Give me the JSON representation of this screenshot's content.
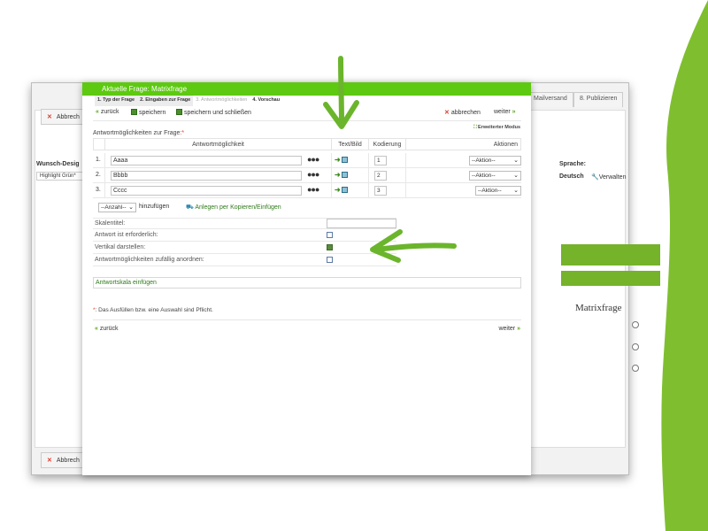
{
  "colors": {
    "accent_green": "#5dc910",
    "blob_green": "#7fbf2f",
    "link_green": "#5ba71c",
    "cancel_red": "#e03a2b"
  },
  "background": {
    "tabs": [
      "Mailversand",
      "8. Publizieren"
    ],
    "cancel_label": "Abbrech",
    "left_heading": "Wunsch-Desig",
    "left_value": "Highlight Grün*",
    "language_heading": "Sprache:",
    "language_value": "Deutsch",
    "manage_label": "Verwalten",
    "manage_icon": "wrench-icon",
    "preview_title": "Matrixfrage",
    "radio_count": 3
  },
  "modal": {
    "title": "Aktuelle Frage: Matrixfrage",
    "steps": [
      {
        "label": "1. Typ der Frage",
        "state": "done"
      },
      {
        "label": "2. Eingaben zur Frage",
        "state": "done"
      },
      {
        "label": "3. Antwortmöglichkeiten",
        "state": "inactive"
      },
      {
        "label": "4. Vorschau",
        "state": "current"
      }
    ],
    "toolbar": {
      "back": "zurück",
      "back_icon": "«",
      "save": "speichern",
      "save_close": "speichern und schließen",
      "cancel": "abbrechen",
      "cancel_icon": "✕",
      "next": "weiter",
      "next_icon": "»"
    },
    "answers_label": "Antwortmöglichkeiten zur Frage",
    "required_mark": ":*",
    "advanced_mode": "Erweiterter Modus",
    "table": {
      "headers": {
        "answer": "Antwortmöglichkeit",
        "textimage": "Text/Bild",
        "coding": "Kodierung",
        "actions": "Aktionen"
      },
      "rows": [
        {
          "num": "1.",
          "answer": "Aaaa",
          "code": "1",
          "action": "--Aktion--"
        },
        {
          "num": "2.",
          "answer": "Bbbb",
          "code": "2",
          "action": "--Aktion--"
        },
        {
          "num": "3.",
          "answer": "Cccc",
          "code": "3",
          "action": "--Aktion--"
        }
      ],
      "dots": "●●●"
    },
    "add": {
      "count_select": "--Anzahl--",
      "add_label": "hinzufügen",
      "copy_paste": "Anlegen per Kopieren/Einfügen"
    },
    "options": [
      {
        "label": "Skalentitel:",
        "control": "text"
      },
      {
        "label": "Antwort ist erforderlich:",
        "control": "checkbox",
        "checked": false
      },
      {
        "label": "Vertikal darstellen:",
        "control": "checkbox",
        "checked": true
      },
      {
        "label": "Antwortmöglichkeiten zufällig anordnen:",
        "control": "checkbox",
        "checked": false
      }
    ],
    "scale_insert": "Antwortskala einfügen",
    "footnote_mark": "*",
    "footnote": ": Das Ausfüllen bzw. eine Auswahl sind Pflicht.",
    "bottom_back": "zurück",
    "bottom_next": "weiter"
  }
}
